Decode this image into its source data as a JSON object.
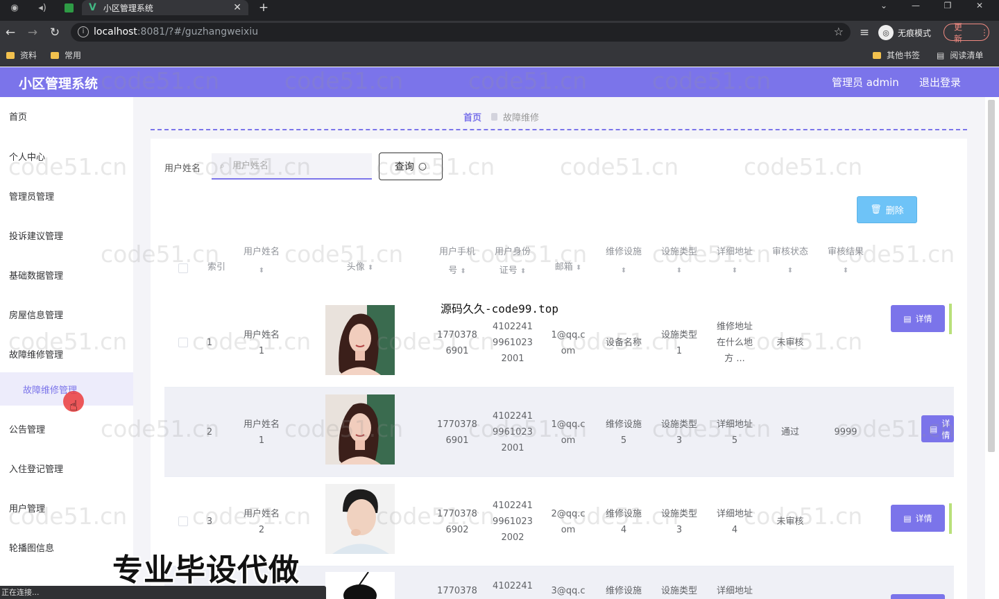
{
  "browser": {
    "tab_title": "小区管理系统",
    "url_host": "localhost",
    "url_rest": ":8081/?#/guzhangweixiu",
    "incognito_label": "无痕模式",
    "update_label": "更新",
    "bookmarks": [
      "资料",
      "常用"
    ],
    "bookmarks_right": [
      "其他书签",
      "阅读清单"
    ]
  },
  "header": {
    "title": "小区管理系统",
    "admin_label": "管理员 admin",
    "logout_label": "退出登录",
    "accent_color": "#7b74ea"
  },
  "sidebar": {
    "items": [
      {
        "label": "首页"
      },
      {
        "label": "个人中心"
      },
      {
        "label": "管理员管理"
      },
      {
        "label": "投诉建议管理"
      },
      {
        "label": "基础数据管理"
      },
      {
        "label": "房屋信息管理"
      },
      {
        "label": "故障维修管理"
      },
      {
        "label": "公告管理"
      },
      {
        "label": "入住登记管理"
      },
      {
        "label": "用户管理"
      },
      {
        "label": "轮播图信息"
      }
    ],
    "active_sub": "故障维修管理"
  },
  "breadcrumb": {
    "home": "首页",
    "current": "故障维修"
  },
  "search": {
    "label": "用户姓名",
    "placeholder": "用户姓名",
    "query_label": "查询",
    "delete_label": "删除"
  },
  "table": {
    "headers": {
      "index": "索引",
      "name": "用户姓名",
      "avatar": "头像",
      "phone_1": "用户手机",
      "phone_2": "号",
      "idcard_1": "用户身份",
      "idcard_2": "证号",
      "email": "邮箱",
      "facility": "维修设施",
      "ftype": "设施类型",
      "address": "详细地址",
      "status": "审核状态",
      "result": "审核结果"
    },
    "detail_label": "详情",
    "rows": [
      {
        "index": "1",
        "name_1": "用户姓名",
        "name_2": "1",
        "avatar": "woman-portrait",
        "phone_1": "1770378",
        "phone_2": "6901",
        "id_1": "4102241",
        "id_2": "9961023",
        "id_3": "2001",
        "email_1": "1@qq.c",
        "email_2": "om",
        "facility_1": "设备名称",
        "facility_2": "",
        "ftype_1": "设施类型",
        "ftype_2": "1",
        "addr_1": "维修地址",
        "addr_2": "在什么地",
        "addr_3": "方 ...",
        "status": "未审核",
        "result": ""
      },
      {
        "index": "2",
        "name_1": "用户姓名",
        "name_2": "1",
        "avatar": "woman-portrait",
        "phone_1": "1770378",
        "phone_2": "6901",
        "id_1": "4102241",
        "id_2": "9961023",
        "id_3": "2001",
        "email_1": "1@qq.c",
        "email_2": "om",
        "facility_1": "维修设施",
        "facility_2": "5",
        "ftype_1": "设施类型",
        "ftype_2": "3",
        "addr_1": "详细地址",
        "addr_2": "5",
        "addr_3": "",
        "status": "通过",
        "result": "9999"
      },
      {
        "index": "3",
        "name_1": "用户姓名",
        "name_2": "2",
        "avatar": "man-portrait",
        "phone_1": "1770378",
        "phone_2": "6902",
        "id_1": "4102241",
        "id_2": "9961023",
        "id_3": "2002",
        "email_1": "2@qq.c",
        "email_2": "om",
        "facility_1": "维修设施",
        "facility_2": "4",
        "ftype_1": "设施类型",
        "ftype_2": "3",
        "addr_1": "详细地址",
        "addr_2": "4",
        "addr_3": "",
        "status": "未审核",
        "result": ""
      },
      {
        "index": "",
        "name_1": "",
        "name_2": "",
        "avatar": "cartoon-avatar",
        "phone_1": "1770378",
        "phone_2": "",
        "id_1": "4102241",
        "id_2": "",
        "id_3": "",
        "email_1": "3@qq.c",
        "email_2": "",
        "facility_1": "维修设施",
        "facility_2": "",
        "ftype_1": "设施类型",
        "ftype_2": "",
        "addr_1": "详细地址",
        "addr_2": "",
        "addr_3": "",
        "status": "",
        "result": ""
      }
    ]
  },
  "overlays": {
    "note": "源码久久-code99.top",
    "promo": "专业毕设代做",
    "status": "正在连接...",
    "watermark": "code51.cn"
  }
}
